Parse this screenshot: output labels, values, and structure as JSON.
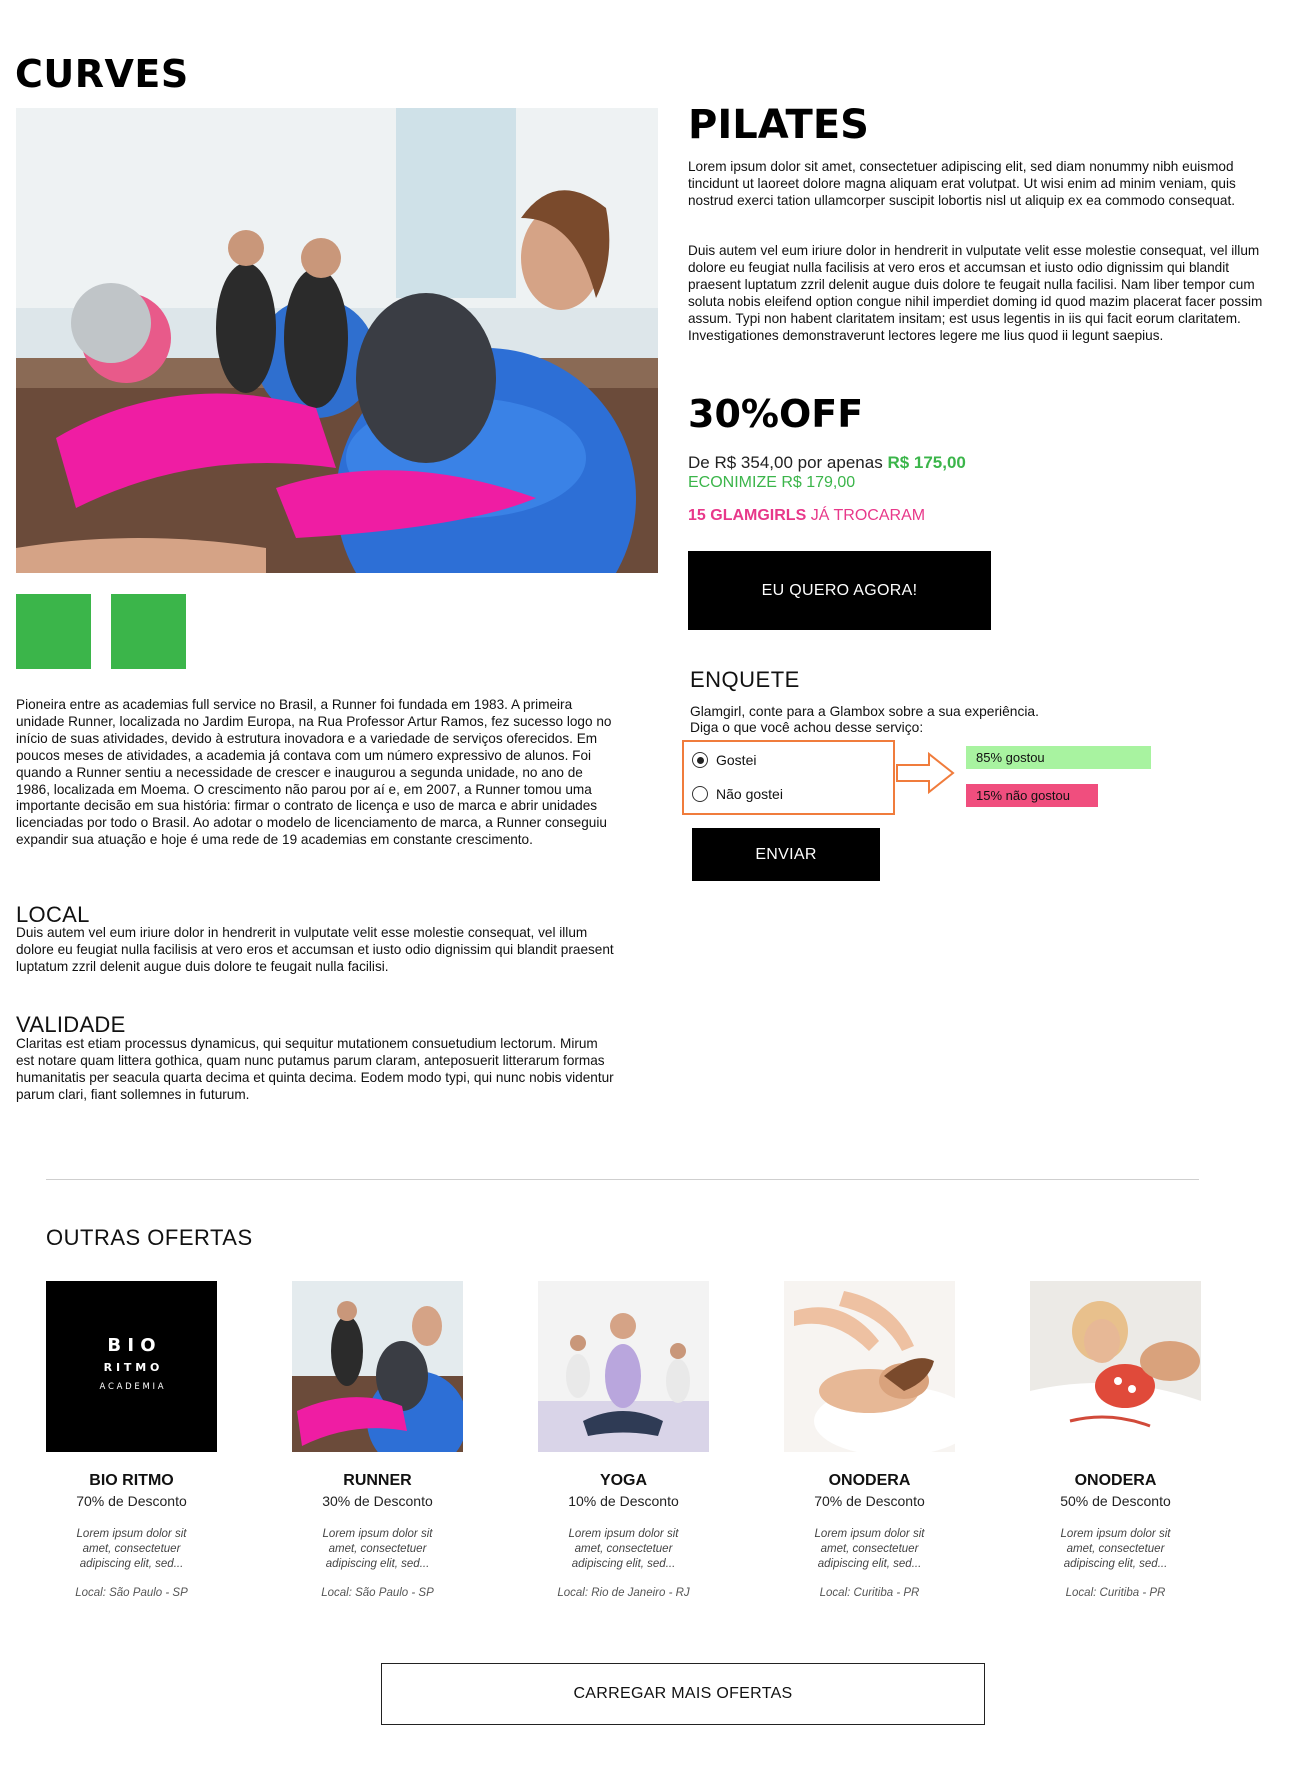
{
  "brand": "CURVES",
  "offer": {
    "title": "PILATES",
    "paragraph1": "Lorem ipsum dolor sit amet, consectetuer adipiscing elit, sed diam nonummy nibh euismod tincidunt ut laoreet dolore magna aliquam erat volutpat. Ut wisi enim ad minim veniam, quis nostrud exerci tation ullamcorper suscipit lobortis nisl ut aliquip ex ea commodo consequat.",
    "paragraph2": "Duis autem vel eum iriure dolor in hendrerit in vulputate velit esse molestie consequat, vel illum dolore eu feugiat nulla facilisis at vero eros et accumsan et iusto odio dignissim qui blandit praesent luptatum zzril delenit augue duis dolore te feugait nulla facilisi. Nam liber tempor cum soluta nobis eleifend option congue nihil imperdiet doming id quod mazim placerat facer possim assum. Typi non habent claritatem insitam; est usus legentis in iis qui facit eorum claritatem. Investigationes demonstraverunt lectores legere me lius quod ii legunt saepius.",
    "discount": "30%OFF",
    "price_prefix": "De R$ 354,00 por apenas",
    "price_new": "R$ 175,00",
    "economize": "ECONIMIZE R$ 179,00",
    "glam_count": "15 GLAMGIRLS",
    "glam_suffix": "JÁ TROCARAM",
    "cta_label": "EU QUERO AGORA!"
  },
  "about": {
    "text": "Pioneira entre as academias full service no Brasil, a Runner foi fundada em 1983. A primeira unidade Runner, localizada no Jardim Europa, na Rua Professor Artur Ramos, fez sucesso logo no início de suas atividades, devido à estrutura inovadora e a variedade de serviços oferecidos. Em poucos meses de atividades, a academia já contava com um número expressivo de alunos. Foi quando a Runner sentiu a necessidade de crescer e inaugurou a segunda unidade, no ano de 1986, localizada em Moema.  O crescimento não parou por aí e, em 2007, a Runner tomou uma importante decisão em sua história: firmar o contrato de licença e uso de marca e abrir unidades licenciadas por todo o Brasil. Ao adotar o modelo de licenciamento de marca, a Runner conseguiu expandir sua atuação e hoje é uma rede de 19 academias em constante crescimento.",
    "local_title": "LOCAL",
    "local_text": "Duis autem vel eum iriure dolor in hendrerit in vulputate velit esse molestie consequat, vel illum dolore eu feugiat nulla facilisis at vero eros et accumsan et iusto odio dignissim qui blandit praesent luptatum zzril delenit augue duis dolore te feugait nulla facilisi.",
    "validade_title": "VALIDADE",
    "validade_text": "Claritas est etiam processus dynamicus, qui sequitur mutationem consuetudium lectorum. Mirum est notare quam littera gothica, quam nunc putamus parum claram, anteposuerit litterarum formas humanitatis per seacula quarta decima et quinta decima. Eodem modo typi, qui nunc nobis videntur parum clari, fiant sollemnes in futurum."
  },
  "poll": {
    "title": "ENQUETE",
    "line1": "Glamgirl, conte para a Glambox sobre a sua experiência.",
    "line2": "Diga o que você achou desse serviço:",
    "option_yes": "Gostei",
    "option_no": "Não gostei",
    "selected": "Gostei",
    "result_yes": "85% gostou",
    "result_no": "15% não gostou",
    "result_yes_pct": 85,
    "result_no_pct": 15,
    "send_label": "ENVIAR"
  },
  "others": {
    "title": "OUTRAS OFERTAS",
    "cards": [
      {
        "name": "BIO RITMO",
        "discount": "70% de Desconto",
        "desc": "Lorem ipsum dolor sit amet, consectetuer adipiscing elit, sed...",
        "local": "Local: São Paulo - SP",
        "logo_line1": "B I O",
        "logo_line2": "R I T M O",
        "logo_line3": "A C A D E M I A"
      },
      {
        "name": "RUNNER",
        "discount": "30% de Desconto",
        "desc": "Lorem ipsum dolor sit amet, consectetuer adipiscing elit, sed...",
        "local": "Local: São Paulo - SP"
      },
      {
        "name": "YOGA",
        "discount": "10% de Desconto",
        "desc": "Lorem ipsum dolor sit amet, consectetuer adipiscing elit, sed...",
        "local": "Local: Rio de Janeiro - RJ"
      },
      {
        "name": "ONODERA",
        "discount": "70% de Desconto",
        "desc": "Lorem ipsum dolor sit amet, consectetuer adipiscing elit, sed...",
        "local": "Local: Curitiba - PR"
      },
      {
        "name": "ONODERA",
        "discount": "50% de Desconto",
        "desc": "Lorem ipsum dolor sit amet, consectetuer adipiscing elit, sed...",
        "local": "Local: Curitiba - PR"
      }
    ],
    "load_more": "CARREGAR MAIS OFERTAS"
  },
  "colors": {
    "accent_green": "#3bb54a",
    "accent_pink": "#e8388a",
    "poll_border": "#f07c3c",
    "bar_yes": "#a8f3a0",
    "bar_no": "#f04e7e"
  }
}
